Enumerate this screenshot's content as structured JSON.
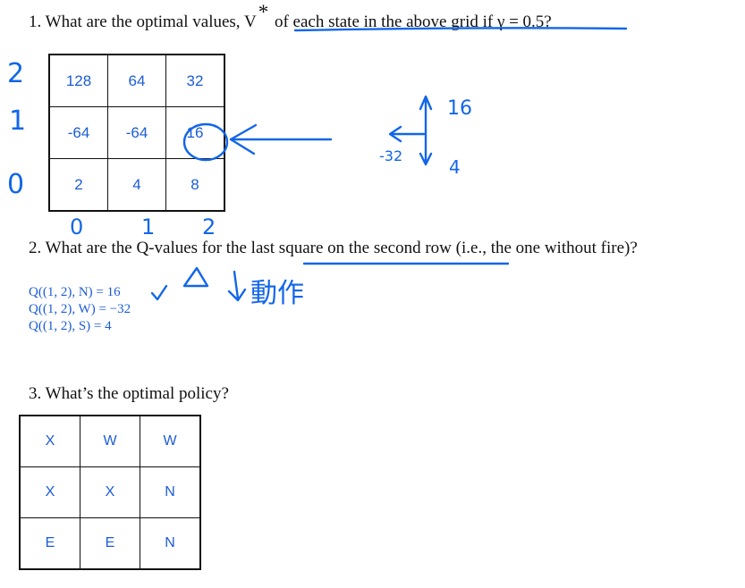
{
  "q1": {
    "prefix": "1. What are the optimal values, V",
    "star": "*",
    "suffix": " of each state in the above grid if γ = 0.5?"
  },
  "grid1": [
    [
      "128",
      "64",
      "32"
    ],
    [
      "-64",
      "-64",
      "16"
    ],
    [
      "2",
      "4",
      "8"
    ]
  ],
  "q2": {
    "text": "2. What are the Q-values for the last square on the second row (i.e., the one without fire)?"
  },
  "qvalues": [
    "Q((1, 2), N) = 16",
    "Q((1, 2), W) = −32",
    "Q((1, 2), S) = 4"
  ],
  "q3": {
    "text": "3. What’s the optimal policy?"
  },
  "grid3": [
    [
      "X",
      "W",
      "W"
    ],
    [
      "X",
      "X",
      "N"
    ],
    [
      "E",
      "E",
      "N"
    ]
  ],
  "handwriting": {
    "row_labels": [
      "2",
      "1",
      "0"
    ],
    "col_labels": [
      "0",
      "1",
      "2"
    ],
    "top_value": "16",
    "left_value": "-32",
    "down_value": "4",
    "note": "動作"
  },
  "colors": {
    "ink": "#1266e8",
    "printed_blue": "#1c5cd6"
  }
}
